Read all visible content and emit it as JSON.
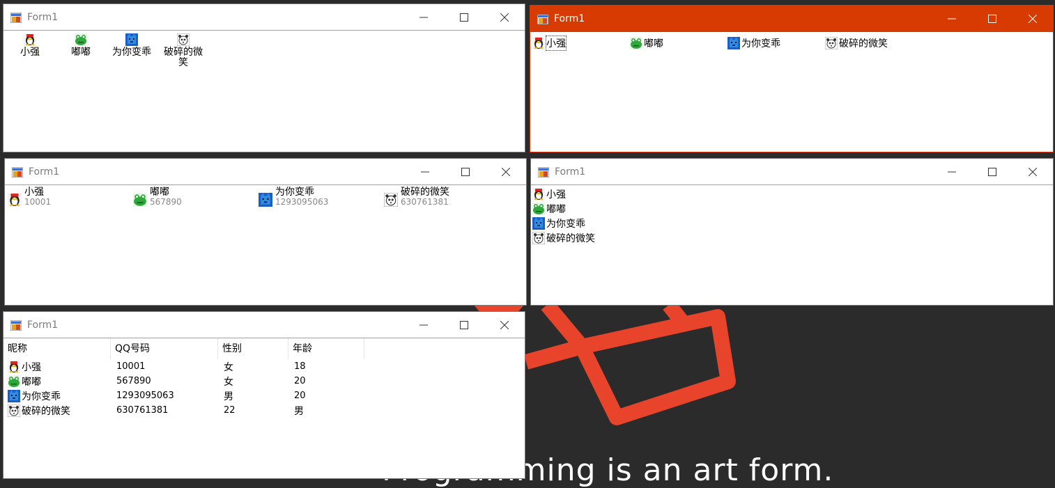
{
  "background": {
    "caption": "Programming is an art form.",
    "accent": "#e8432b",
    "color": "#2b2b2b"
  },
  "contacts": [
    {
      "name": "小强",
      "qq": "10001",
      "gender": "女",
      "age": "18",
      "avatar": "qq-penguin-icon"
    },
    {
      "name": "嘟嘟",
      "qq": "567890",
      "gender": "女",
      "age": "20",
      "avatar": "green-frog-icon"
    },
    {
      "name": "为你变乖",
      "qq": "1293095063",
      "gender": "男",
      "age": "20",
      "avatar": "blue-cat-icon"
    },
    {
      "name": "破碎的微笑",
      "qq": "630761381",
      "gender": "22",
      "age": "男",
      "avatar": "panda-icon"
    }
  ],
  "windows": {
    "large_icon": {
      "title": "Form1",
      "view": "LargeIcon",
      "wrapped_label": [
        "破碎的微",
        "笑"
      ]
    },
    "small_icon": {
      "title": "Form1",
      "view": "SmallIcon",
      "active": true,
      "title_color": "#d83b01"
    },
    "tile": {
      "title": "Form1",
      "view": "Tile"
    },
    "list": {
      "title": "Form1",
      "view": "List"
    },
    "details": {
      "title": "Form1",
      "view": "Details",
      "columns": [
        "昵称",
        "QQ号码",
        "性别",
        "年龄"
      ]
    }
  }
}
